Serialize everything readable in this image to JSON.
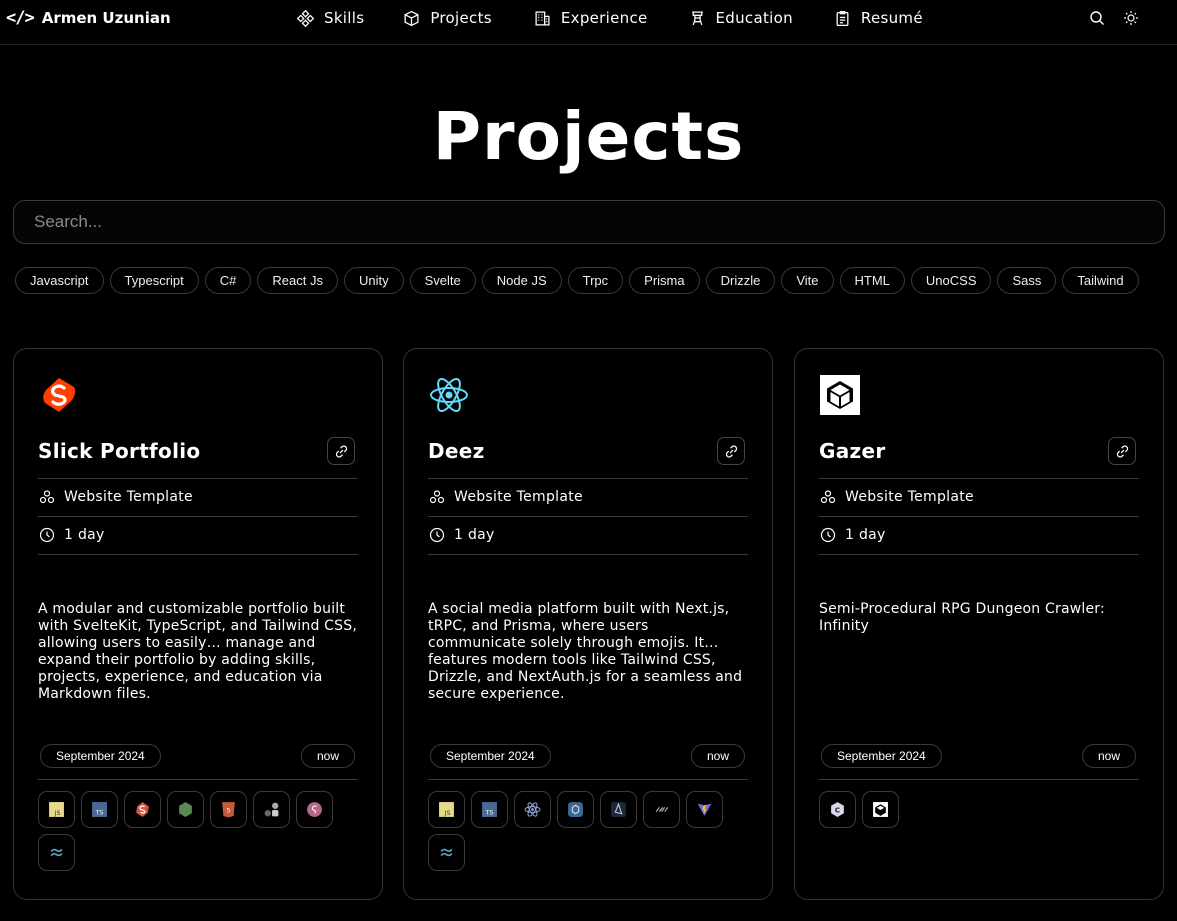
{
  "nav": {
    "brand_icon": "</>",
    "brand_name": "Armen Uzunian",
    "links": [
      {
        "label": "Skills",
        "icon": "skills-icon"
      },
      {
        "label": "Projects",
        "icon": "cube-icon"
      },
      {
        "label": "Experience",
        "icon": "building-icon"
      },
      {
        "label": "Education",
        "icon": "graduation-icon"
      },
      {
        "label": "Resumé",
        "icon": "document-icon"
      }
    ],
    "right_icons": [
      "search-icon",
      "sun-icon"
    ]
  },
  "page_title": "Projects",
  "search": {
    "placeholder": "Search...",
    "value": ""
  },
  "filters": [
    "Javascript",
    "Typescript",
    "C#",
    "React Js",
    "Unity",
    "Svelte",
    "Node JS",
    "Trpc",
    "Prisma",
    "Drizzle",
    "Vite",
    "HTML",
    "UnoCSS",
    "Sass",
    "Tailwind"
  ],
  "projects": [
    {
      "logo": "svelte-logo",
      "name": "Slick Portfolio",
      "type": "Website Template",
      "duration": "1 day",
      "description": "A modular and customizable portfolio built with SvelteKit, TypeScript, and Tailwind CSS, allowing users to easily… manage and expand their portfolio by adding skills, projects, experience, and education via Markdown files.",
      "start": "September 2024",
      "end": "now",
      "skills": [
        "javascript-icon",
        "typescript-icon",
        "svelte-icon",
        "nodejs-icon",
        "html-icon",
        "unocss-icon",
        "sass-icon",
        "tailwind-icon"
      ]
    },
    {
      "logo": "react-logo",
      "name": "Deez",
      "type": "Website Template",
      "duration": "1 day",
      "description": "A social media platform built with Next.js, tRPC, and Prisma, where users communicate solely through emojis. It… features modern tools like Tailwind CSS, Drizzle, and NextAuth.js for a seamless and secure experience.",
      "start": "September 2024",
      "end": "now",
      "skills": [
        "javascript-icon",
        "typescript-icon",
        "react-icon",
        "trpc-icon",
        "prisma-icon",
        "drizzle-icon",
        "vite-icon",
        "tailwind-icon"
      ]
    },
    {
      "logo": "unity-logo",
      "name": "Gazer",
      "type": "Website Template",
      "duration": "1 day",
      "description": "Semi-Procedural RPG Dungeon Crawler: Infinity",
      "start": "September 2024",
      "end": "now",
      "skills": [
        "csharp-icon",
        "unity-icon"
      ]
    }
  ],
  "colors": {
    "background": "#000000",
    "border": "#333333",
    "svelte": "#ff3e00",
    "react": "#61dafb",
    "javascript": "#f7df1e",
    "typescript": "#3178c6"
  }
}
